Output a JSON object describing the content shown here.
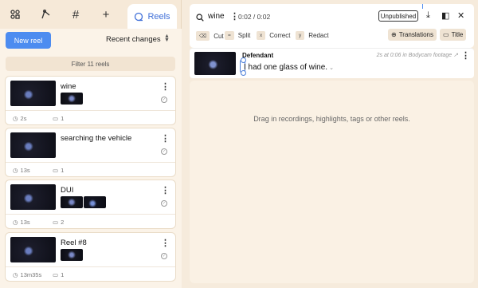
{
  "left": {
    "icons": [
      "team-icon",
      "pen-icon",
      "hash-icon",
      "plus-icon"
    ],
    "reels_tab_label": "Reels",
    "new_reel_label": "New reel",
    "sort_label": "Recent changes",
    "filter_label": "Filter 11 reels",
    "reels": [
      {
        "title": "wine",
        "duration": "2s",
        "count": "1"
      },
      {
        "title": "searching the vehicle",
        "duration": "13s",
        "count": "1"
      },
      {
        "title": "DUI",
        "duration": "13s",
        "count": "2"
      },
      {
        "title": "Reel #8",
        "duration": "13m35s",
        "count": "1"
      }
    ]
  },
  "editor": {
    "reel_name": "wine",
    "time": "0:02 / 0:02",
    "status": "Unpublished",
    "tools": [
      {
        "key": "⌫",
        "label": "Cut"
      },
      {
        "key": "=",
        "label": "Split"
      },
      {
        "key": "x",
        "label": "Correct"
      },
      {
        "key": "y",
        "label": "Redact"
      }
    ],
    "translations_label": "Translations",
    "title_label": "Title",
    "clip": {
      "speaker": "Defendant",
      "source": "2s at 0:06 in Bodycam footage ↗",
      "text": "I had one glass of wine."
    },
    "drop_hint": "Drag in recordings, highlights, tags or other reels."
  }
}
